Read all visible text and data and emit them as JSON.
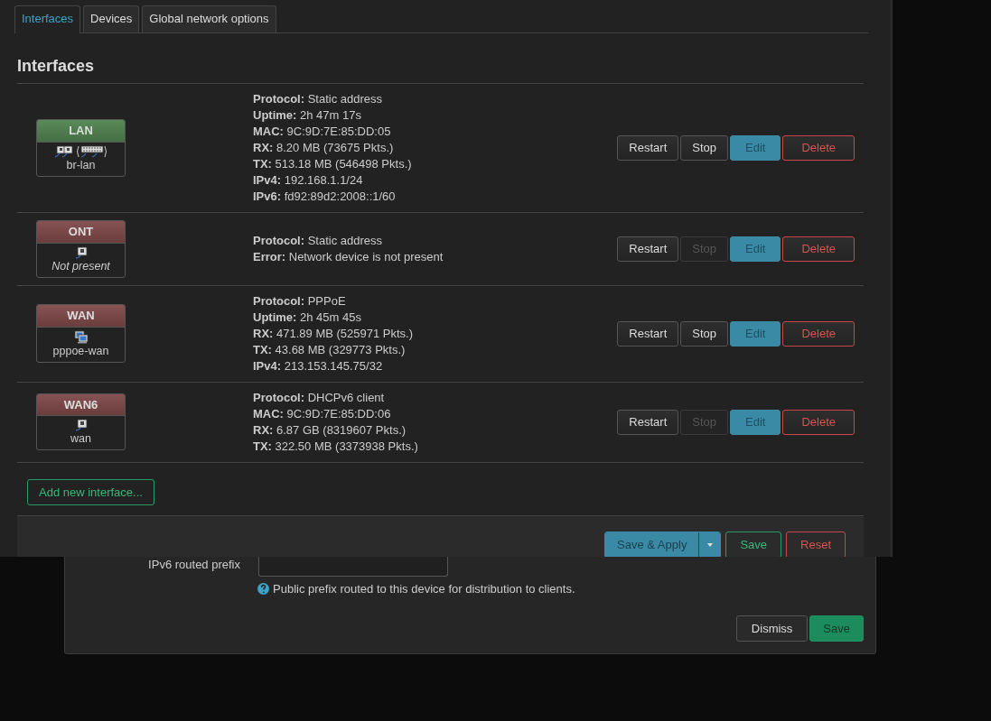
{
  "tabs": [
    {
      "label": "Interfaces",
      "selected": true
    },
    {
      "label": "Devices",
      "selected": false
    },
    {
      "label": "Global network options",
      "selected": false
    }
  ],
  "section_title": "Interfaces",
  "interfaces": [
    {
      "name": "LAN",
      "up": true,
      "kind": "bridge",
      "device": "br-lan",
      "present": true,
      "details": [
        {
          "label": "Protocol:",
          "value": "Static address"
        },
        {
          "label": "Uptime:",
          "value": "2h 47m 17s"
        },
        {
          "label": "MAC:",
          "value": "9C:9D:7E:85:DD:05"
        },
        {
          "label": "RX:",
          "value": "8.20 MB (73675 Pkts.)"
        },
        {
          "label": "TX:",
          "value": "513.18 MB (546498 Pkts.)"
        },
        {
          "label": "IPv4:",
          "value": "192.168.1.1/24"
        },
        {
          "label": "IPv6:",
          "value": "fd92:89d2:2008::1/60"
        }
      ],
      "buttons": [
        {
          "label": "Restart",
          "kind": "default",
          "disabled": false
        },
        {
          "label": "Stop",
          "kind": "default",
          "disabled": false
        },
        {
          "label": "Edit",
          "kind": "edit",
          "disabled": false
        },
        {
          "label": "Delete",
          "kind": "delete",
          "disabled": false
        }
      ]
    },
    {
      "name": "ONT",
      "up": false,
      "kind": "ethernet",
      "device": "Not present",
      "present": false,
      "details": [
        {
          "label": "Protocol:",
          "value": "Static address"
        },
        {
          "label": "Error:",
          "value": "Network device is not present"
        }
      ],
      "buttons": [
        {
          "label": "Restart",
          "kind": "default",
          "disabled": false
        },
        {
          "label": "Stop",
          "kind": "default",
          "disabled": true
        },
        {
          "label": "Edit",
          "kind": "edit",
          "disabled": false
        },
        {
          "label": "Delete",
          "kind": "delete",
          "disabled": false
        }
      ]
    },
    {
      "name": "WAN",
      "up": false,
      "kind": "pppoe",
      "device": "pppoe-wan",
      "present": true,
      "details": [
        {
          "label": "Protocol:",
          "value": "PPPoE"
        },
        {
          "label": "Uptime:",
          "value": "2h 45m 45s"
        },
        {
          "label": "RX:",
          "value": "471.89 MB (525971 Pkts.)"
        },
        {
          "label": "TX:",
          "value": "43.68 MB (329773 Pkts.)"
        },
        {
          "label": "IPv4:",
          "value": "213.153.145.75/32"
        }
      ],
      "buttons": [
        {
          "label": "Restart",
          "kind": "default",
          "disabled": false
        },
        {
          "label": "Stop",
          "kind": "default",
          "disabled": false
        },
        {
          "label": "Edit",
          "kind": "edit",
          "disabled": false
        },
        {
          "label": "Delete",
          "kind": "delete",
          "disabled": false
        }
      ]
    },
    {
      "name": "WAN6",
      "up": false,
      "kind": "ethernet",
      "device": "wan",
      "present": true,
      "details": [
        {
          "label": "Protocol:",
          "value": "DHCPv6 client"
        },
        {
          "label": "MAC:",
          "value": "9C:9D:7E:85:DD:06"
        },
        {
          "label": "RX:",
          "value": "6.87 GB (8319607 Pkts.)"
        },
        {
          "label": "TX:",
          "value": "322.50 MB (3373938 Pkts.)"
        }
      ],
      "buttons": [
        {
          "label": "Restart",
          "kind": "default",
          "disabled": false
        },
        {
          "label": "Stop",
          "kind": "default",
          "disabled": true
        },
        {
          "label": "Edit",
          "kind": "edit",
          "disabled": false
        },
        {
          "label": "Delete",
          "kind": "delete",
          "disabled": false
        }
      ]
    }
  ],
  "add_button": "Add new interface...",
  "actions": {
    "save_apply": "Save & Apply",
    "save": "Save",
    "reset": "Reset"
  },
  "modal": {
    "field_label": "IPv6 routed prefix",
    "help": "Public prefix routed to this device for distribution to clients.",
    "dismiss": "Dismiss",
    "save": "Save"
  }
}
